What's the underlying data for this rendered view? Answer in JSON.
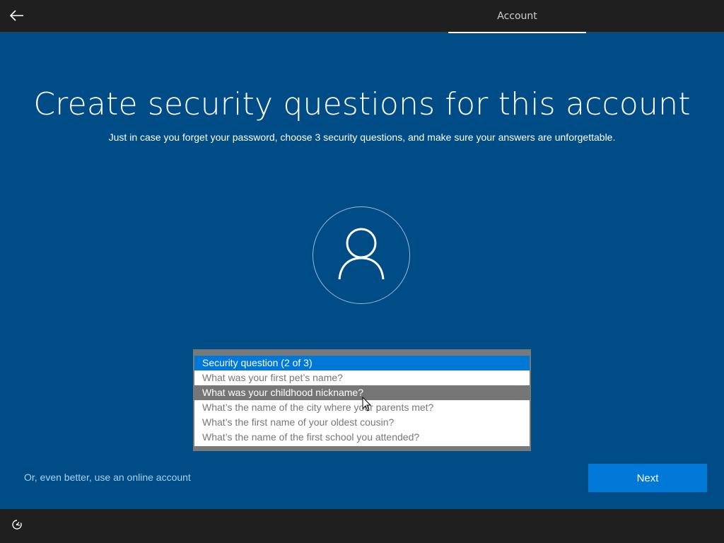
{
  "header": {
    "back_icon": "arrow-left-icon",
    "tab_label": "Account"
  },
  "main": {
    "title": "Create security questions for this account",
    "subtitle": "Just in case you forget your password, choose 3 security questions, and make sure your answers are unforgettable.",
    "avatar_icon": "user-icon"
  },
  "security_dropdown": {
    "selected_index": 0,
    "hovered_index": 2,
    "options": [
      "Security question (2 of 3)",
      "What was your first pet’s name?",
      "What was your childhood nickname?",
      "What’s the name of the city where your parents met?",
      "What’s the first name of your oldest cousin?",
      "What’s the name of the first school you attended?"
    ]
  },
  "footer": {
    "online_account_link": "Or, even better, use an online account",
    "next_label": "Next",
    "ease_of_access_icon": "ease-of-access-icon"
  },
  "colors": {
    "background": "#004c87",
    "bar": "#1f1f1f",
    "accent": "#0078d7",
    "link": "#a6d2f5",
    "hover": "#767676"
  }
}
